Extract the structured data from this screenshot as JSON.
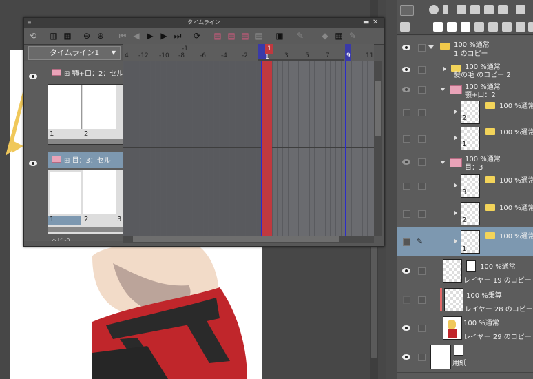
{
  "timeline": {
    "title": "タイムライン",
    "selector_value": "タイムライン1",
    "ruler_top_label": "-1",
    "ruler_marks": [
      "4",
      "-12",
      "-10",
      "-8",
      "-6",
      "-4",
      "-2",
      "1",
      "3",
      "5",
      "7",
      "9",
      "11"
    ],
    "current_frame_badge": "1",
    "tracks": [
      {
        "label": "顎+口：2：セル",
        "cells": [
          "1",
          "2"
        ]
      },
      {
        "label": "目：3：セル",
        "cells": [
          "1",
          "2",
          "3"
        ]
      }
    ],
    "partial_track_label": "ヘビ -0 ..."
  },
  "layers": [
    {
      "line1": "100 %通常",
      "line2": "1 のコピー",
      "type": "folder-open"
    },
    {
      "line1": "100 %通常",
      "line2": "髪の毛 のコピー 2",
      "type": "folder"
    },
    {
      "line1": "100 %通常",
      "line2": "顎+口：2",
      "type": "anim-open"
    },
    {
      "line1": "100 %通常",
      "line2": "2",
      "type": "cell"
    },
    {
      "line1": "100 %通常",
      "line2": "1",
      "type": "cell"
    },
    {
      "line1": "100 %通常",
      "line2": "目：3",
      "type": "anim-open"
    },
    {
      "line1": "100 %通常",
      "line2": "3",
      "type": "cell"
    },
    {
      "line1": "100 %通常",
      "line2": "2",
      "type": "cell"
    },
    {
      "line1": "100 %通常",
      "line2": "1",
      "type": "cell-selected"
    },
    {
      "line1": "100 %通常",
      "line2": "レイヤー 19 のコピー",
      "type": "raster"
    },
    {
      "line1": "100 %乗算",
      "line2": "レイヤー 28 のコピー",
      "type": "raster"
    },
    {
      "line1": "100 %通常",
      "line2": "レイヤー 29 のコピー",
      "type": "raster"
    },
    {
      "line1": "用紙",
      "line2": "",
      "type": "paper"
    }
  ],
  "colors": {
    "playhead": "#c0393f",
    "range_marker": "#2c2cc8",
    "selection": "#7d98b0"
  }
}
